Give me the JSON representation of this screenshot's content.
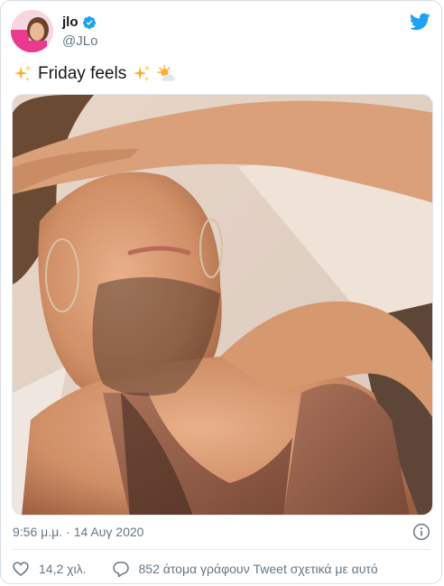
{
  "user": {
    "display_name": "jlo",
    "handle": "@JLo",
    "verified": true
  },
  "tweet": {
    "text": "Friday feels",
    "emojis": [
      "sparkles",
      "sparkles",
      "sun-behind-cloud"
    ]
  },
  "meta": {
    "time": "9:56 μ.μ.",
    "separator": "·",
    "date": "14 Αυγ 2020"
  },
  "actions": {
    "likes": "14,2 χιλ.",
    "replies": "852 άτομα γράφουν Tweet σχετικά με αυτό"
  },
  "colors": {
    "brand_blue": "#1DA1F2",
    "secondary_text": "#657786",
    "primary_text": "#14171A"
  },
  "icons": [
    "twitter-bird-icon",
    "verified-badge-icon",
    "info-icon",
    "heart-icon",
    "reply-bubble-icon"
  ]
}
